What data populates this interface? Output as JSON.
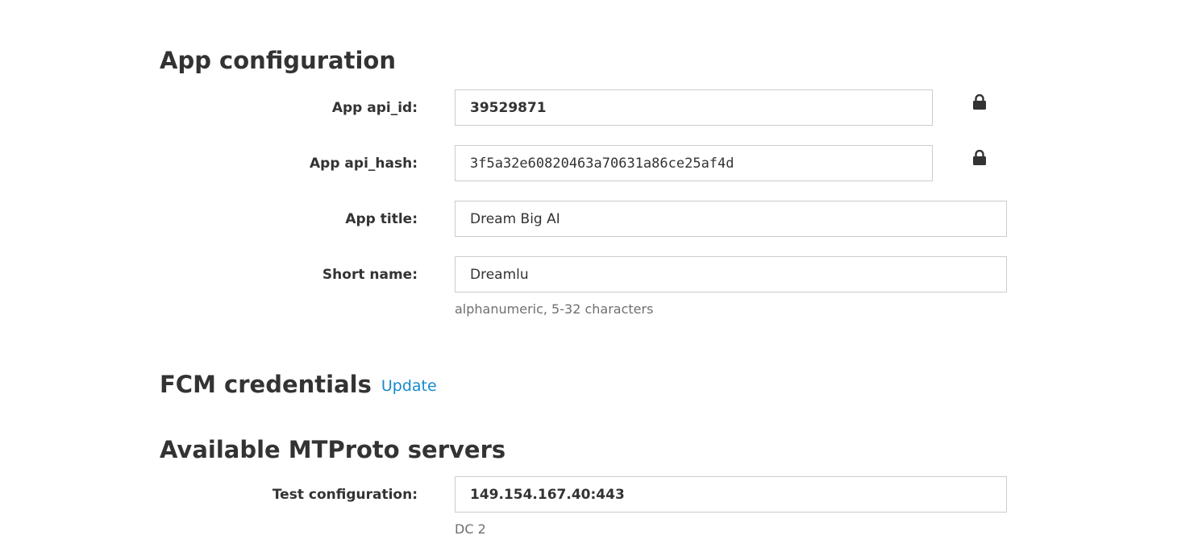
{
  "app_config": {
    "title": "App configuration",
    "api_id": {
      "label": "App api_id:",
      "value": "39529871"
    },
    "api_hash": {
      "label": "App api_hash:",
      "value": "3f5a32e60820463a70631a86ce25af4d"
    },
    "app_title": {
      "label": "App title:",
      "value": "Dream Big AI"
    },
    "short_name": {
      "label": "Short name:",
      "value": "Dreamlu",
      "hint": "alphanumeric, 5-32 characters"
    }
  },
  "fcm": {
    "title": "FCM credentials",
    "update_label": "Update"
  },
  "mtproto": {
    "title": "Available MTProto servers",
    "test_config": {
      "label": "Test configuration:",
      "value": "149.154.167.40:443",
      "hint": "DC 2"
    }
  },
  "icons": {
    "lock": "lock-icon"
  },
  "colors": {
    "link": "#168acd",
    "text": "#333333",
    "hint": "#6f6f6f",
    "border": "#cccccc"
  }
}
